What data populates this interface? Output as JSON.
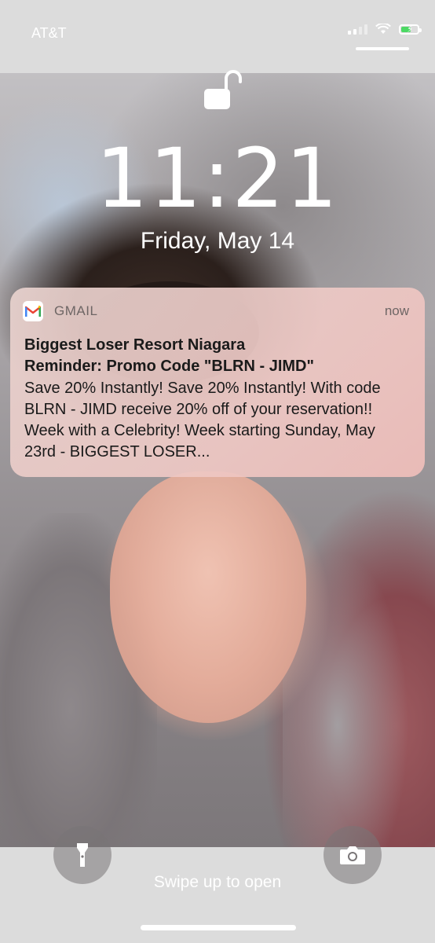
{
  "status_bar": {
    "carrier": "AT&T"
  },
  "lock_screen": {
    "time": "11:21",
    "date": "Friday, May 14",
    "lock_state": "unlocked"
  },
  "notification": {
    "app": "GMAIL",
    "time": "now",
    "title_line1": "Biggest Loser Resort Niagara",
    "title_line2": "Reminder: Promo Code \"BLRN - JIMD\"",
    "body": "Save 20% Instantly! Save 20% Instantly! With code BLRN - JIMD receive 20% off of your reservation!! Week with a Celebrity! Week starting Sunday, May 23rd - BIGGEST LOSER..."
  },
  "bottom": {
    "swipe_hint": "Swipe up to open",
    "left_button": "flashlight-icon",
    "right_button": "camera-icon"
  },
  "colors": {
    "battery_fill": "#4cd964",
    "gmail_red": "#ea4335",
    "gmail_blue": "#4285f4",
    "gmail_green": "#34a853",
    "gmail_yellow": "#fbbc04"
  }
}
